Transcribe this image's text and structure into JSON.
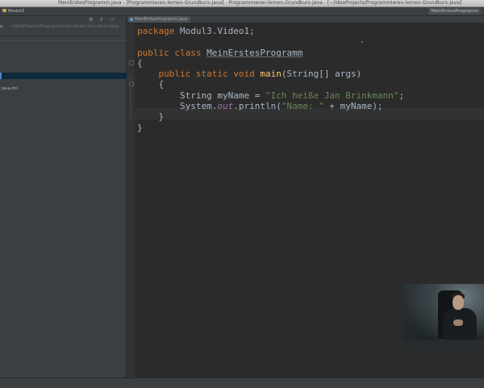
{
  "window": {
    "title": "MeinErstesProgramm.java - [Programmieren-lernen-Grundkurs-Java] - Programmieren-lernen-Grundkurs-Java - [~/IdeaProjects/Programmieren-lernen-Grundkurs-Java]"
  },
  "navbar": {
    "left_crumb": "Modul3",
    "right_crumb": "MeinErstesProgramm"
  },
  "sidebar": {
    "project_label": "a",
    "project_path": "~/IdeaProjects/Programmieren-lernen-Grundkurs-Java",
    "tools": "⚙ ↕ ⊣",
    "items": [
      {
        "label": ""
      },
      {
        "label": ""
      },
      {
        "label": ""
      },
      {
        "label": "Java.iml"
      }
    ]
  },
  "tabs": [
    {
      "label": "MeinErstesProgramm.java"
    }
  ],
  "editor": {
    "lines": [
      {
        "kw": "package",
        "rest": " Modul3.Video1;"
      },
      {
        "blank": ""
      },
      {
        "kw1": "public",
        "kw2": "class",
        "name": "MeinErstesProgramm"
      },
      {
        "brace": "{"
      },
      {
        "indent": "    ",
        "kw1": "public",
        "kw2": "static",
        "kw3": "void",
        "fn": "main",
        "rest": "(String[] args)"
      },
      {
        "indent": "    ",
        "brace": "{"
      },
      {
        "indent": "        ",
        "type": "String",
        "var": " myName = ",
        "str": "\"Ich heiße Jan Brinkmann\"",
        "end": ";"
      },
      {
        "indent": "        ",
        "pre": "System.",
        "field": "out",
        "mid": ".println(",
        "str": "\"Name: \"",
        "post": " + myName);"
      },
      {
        "indent": "    ",
        "brace": "}"
      },
      {
        "brace": "}"
      }
    ]
  },
  "colors": {
    "keyword": "#cc7832",
    "string": "#6a8759",
    "method": "#ffc66d",
    "static_field": "#9876aa",
    "text": "#a9b7c6",
    "background": "#2b2b2b"
  }
}
